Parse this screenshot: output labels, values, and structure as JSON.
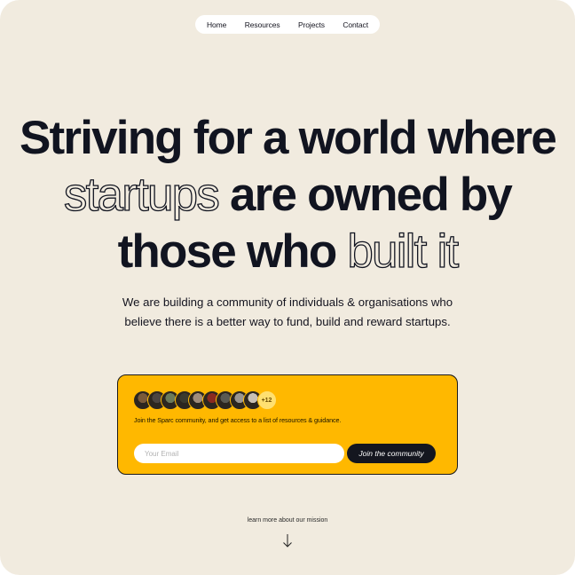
{
  "nav": {
    "items": [
      {
        "label": "Home"
      },
      {
        "label": "Resources"
      },
      {
        "label": "Projects"
      },
      {
        "label": "Contact"
      }
    ]
  },
  "hero": {
    "line1": "Striving for a world where",
    "line2_outline": "startups",
    "line2_rest": " are owned by",
    "line3_rest": "those who ",
    "line3_outline": "built it",
    "subtitle": "We are building a community of individuals & organisations who believe there is a better way to fund, build and reward startups."
  },
  "signup": {
    "avatars": [
      {
        "name": "avatar-1-icon",
        "color": "#7a5a3a"
      },
      {
        "name": "avatar-2-icon",
        "color": "#4a4440"
      },
      {
        "name": "avatar-3-icon",
        "color": "#6a7a5a"
      },
      {
        "name": "avatar-4-icon",
        "color": "#3a3a2e"
      },
      {
        "name": "avatar-5-icon",
        "color": "#a08c7a"
      },
      {
        "name": "avatar-6-icon",
        "color": "#8a2a20"
      },
      {
        "name": "avatar-7-icon",
        "color": "#5a5a52"
      },
      {
        "name": "avatar-8-icon",
        "color": "#9a9590"
      },
      {
        "name": "avatar-9-icon",
        "color": "#c8c0b4"
      }
    ],
    "more_count": "+12",
    "description": "Join the Sparc community, and get access to a list of resources & guidance.",
    "email_placeholder": "Your Email",
    "button_label": "Join the community"
  },
  "footer": {
    "mission_link": "learn more about our mission"
  }
}
